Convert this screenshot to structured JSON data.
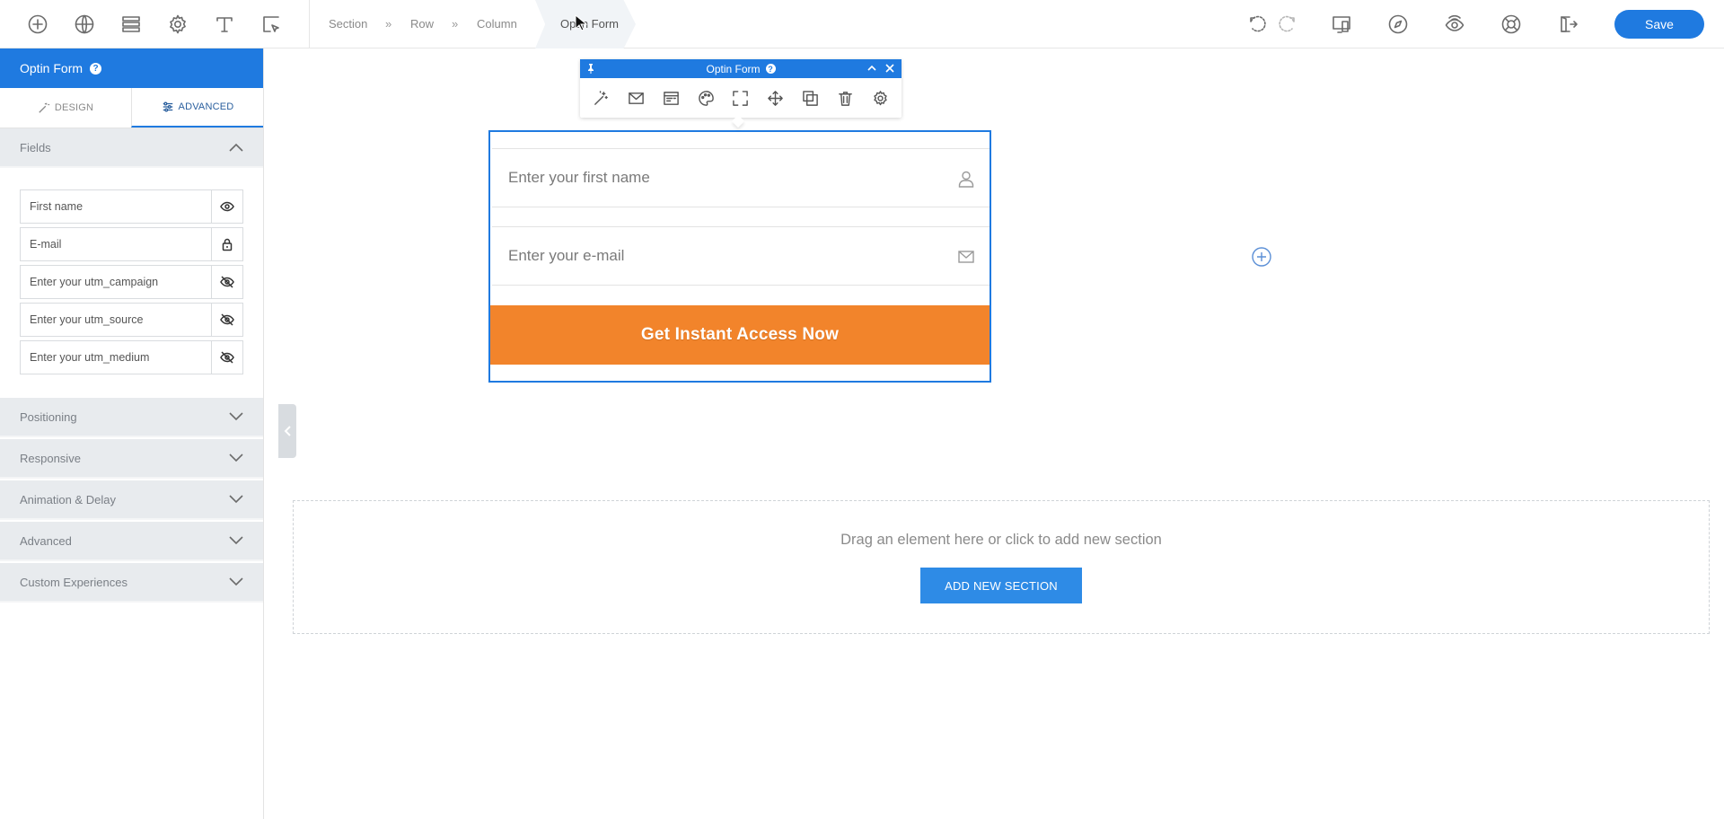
{
  "topbar": {
    "icons": [
      "add-icon",
      "globe-icon",
      "layout-icon",
      "gear-icon",
      "text-icon",
      "select-element-icon"
    ],
    "breadcrumb": [
      "Section",
      "Row",
      "Column",
      "Optin Form"
    ],
    "breadcrumb_sep": "»",
    "right_icons": [
      "undo-icon",
      "redo-icon",
      "responsive-icon",
      "compass-icon",
      "preview-icon",
      "help-icon",
      "exit-icon"
    ],
    "save_label": "Save"
  },
  "panel": {
    "title": "Optin Form",
    "help_glyph": "?",
    "tabs": [
      {
        "label": "DESIGN",
        "active": false
      },
      {
        "label": "ADVANCED",
        "active": true
      }
    ],
    "fields_section": "Fields",
    "fields": [
      {
        "name": "First name",
        "icon": "eye-icon"
      },
      {
        "name": "E-mail",
        "icon": "lock-icon"
      },
      {
        "name": "Enter your utm_campaign",
        "icon": "eye-off-icon"
      },
      {
        "name": "Enter your utm_source",
        "icon": "eye-off-icon"
      },
      {
        "name": "Enter your utm_medium",
        "icon": "eye-off-icon"
      }
    ],
    "sections": [
      "Positioning",
      "Responsive",
      "Animation & Delay",
      "Advanced",
      "Custom Experiences"
    ]
  },
  "toolbar": {
    "title": "Optin Form",
    "help_glyph": "?",
    "tools": [
      "magic-wand-icon",
      "email-icon",
      "form-icon",
      "palette-icon",
      "fullscreen-icon",
      "move-icon",
      "duplicate-icon",
      "trash-icon",
      "settings-icon"
    ]
  },
  "form": {
    "first_name_placeholder": "Enter your first name",
    "email_placeholder": "Enter your e-mail",
    "cta_label": "Get Instant Access Now",
    "cta_color": "#f2842b"
  },
  "dropzone": {
    "text": "Drag an element here or click to add new section",
    "button_label": "ADD NEW SECTION"
  },
  "colors": {
    "accent": "#1f7ae0",
    "panel_header": "#1f7ae0",
    "section_bg": "#e8ebee"
  }
}
